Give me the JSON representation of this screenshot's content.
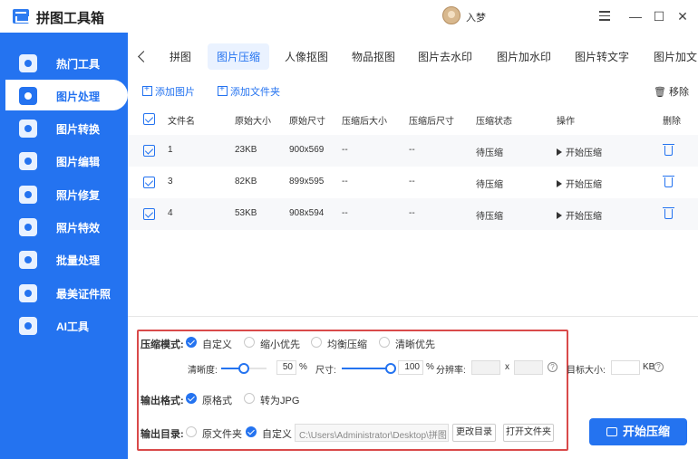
{
  "app": {
    "title": "拼图工具箱",
    "username": "入梦"
  },
  "sidebar": {
    "items": [
      {
        "label": "热门工具"
      },
      {
        "label": "图片处理"
      },
      {
        "label": "图片转换"
      },
      {
        "label": "图片编辑"
      },
      {
        "label": "照片修复"
      },
      {
        "label": "照片特效"
      },
      {
        "label": "批量处理"
      },
      {
        "label": "最美证件照"
      },
      {
        "label": "AI工具"
      }
    ]
  },
  "tabs": [
    "拼图",
    "图片压缩",
    "人像抠图",
    "物品抠图",
    "图片去水印",
    "图片加水印",
    "图片转文字",
    "图片加文"
  ],
  "toolbar": {
    "add_image": "添加图片",
    "add_folder": "添加文件夹",
    "remove": "移除"
  },
  "table": {
    "headers": [
      "文件名",
      "原始大小",
      "原始尺寸",
      "压缩后大小",
      "压缩后尺寸",
      "压缩状态",
      "操作",
      "删除"
    ],
    "rows": [
      {
        "name": "1",
        "size": "23KB",
        "dims": "900x569",
        "c_size": "--",
        "c_dims": "--",
        "status": "待压缩",
        "action": "开始压缩"
      },
      {
        "name": "3",
        "size": "82KB",
        "dims": "899x595",
        "c_size": "--",
        "c_dims": "--",
        "status": "待压缩",
        "action": "开始压缩"
      },
      {
        "name": "4",
        "size": "53KB",
        "dims": "908x594",
        "c_size": "--",
        "c_dims": "--",
        "status": "待压缩",
        "action": "开始压缩"
      }
    ]
  },
  "settings": {
    "mode_label": "压缩模式:",
    "modes": [
      "自定义",
      "缩小优先",
      "均衡压缩",
      "清晰优先"
    ],
    "clarity_label": "清晰度:",
    "clarity_value": "50",
    "size_label": "尺寸:",
    "size_value": "100",
    "percent": "%",
    "resolution_label": "分辨率:",
    "x_label": "x",
    "target_label": "目标大小:",
    "kb_unit": "KB",
    "format_label": "输出格式:",
    "formats": [
      "原格式",
      "转为JPG"
    ],
    "dir_label": "输出目录:",
    "dirs": [
      "原文件夹",
      "自定义"
    ],
    "dir_path": "C:\\Users\\Administrator\\Desktop\\拼图",
    "change_dir": "更改目录",
    "open_folder": "打开文件夹"
  },
  "start_button": "开始压缩",
  "colors": {
    "accent": "#2473f0",
    "highlight_border": "#d94a4a"
  }
}
